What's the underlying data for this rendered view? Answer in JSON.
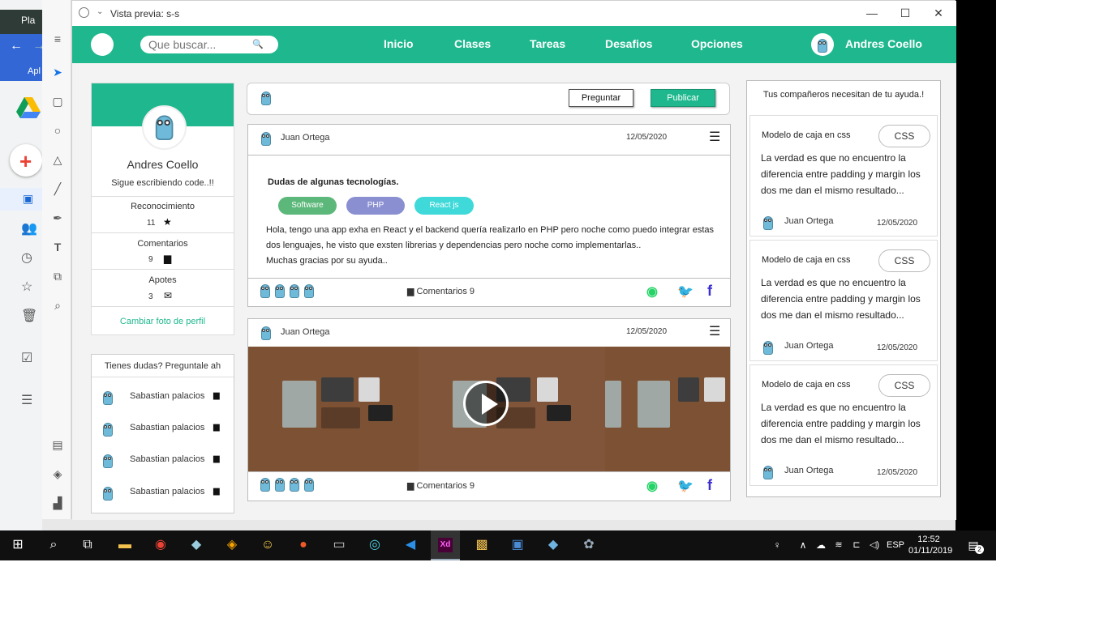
{
  "background": {
    "tab_text": "Pla",
    "apps_label": "Apl"
  },
  "window": {
    "title": "Vista previa: s-s",
    "minimize": "—",
    "maximize": "☐",
    "close": "✕"
  },
  "nav": {
    "search_placeholder": "Que buscar...",
    "links": [
      "Inicio",
      "Clases",
      "Tareas",
      "Desafios",
      "Opciones"
    ],
    "user_name": "Andres Coello"
  },
  "profile": {
    "name": "Andres Coello",
    "subtitle": "Sigue escribiendo code..!!",
    "stats": [
      {
        "label": "Reconocimiento",
        "value": "11",
        "icon": "star-icon"
      },
      {
        "label": "Comentarios",
        "value": "9",
        "icon": "comment-icon"
      },
      {
        "label": "Apotes",
        "value": "3",
        "icon": "mail-icon"
      }
    ],
    "change_photo": "Cambiar  foto de perfil"
  },
  "help": {
    "title": "Tienes dudas? Preguntale ah",
    "users": [
      "Sabastian palacios",
      "Sabastian palacios",
      "Sabastian palacios",
      "Sabastian palacios"
    ]
  },
  "composer": {
    "ask_label": "Preguntar",
    "publish_label": "Publicar"
  },
  "posts": [
    {
      "author": "Juan Ortega",
      "date": "12/05/2020",
      "title": "Dudas de algunas tecnologías.",
      "tags": [
        "Software",
        "PHP",
        "React js"
      ],
      "body": [
        "Hola, tengo una app exha en React y el backend quería realizarlo en PHP pero noche como puedo integrar estas",
        "dos lenguajes, he visto que exsten librerias y dependencias pero noche como implementarlas..",
        "Muchas gracias por su ayuda.."
      ],
      "comments": "Comentarios 9"
    },
    {
      "author": "Juan Ortega",
      "date": "12/05/2020",
      "comments": "Comentarios 9"
    }
  ],
  "right": {
    "title": "Tus compañeros necesitan de tu ayuda.!",
    "cards": [
      {
        "title": "Modelo de caja en css",
        "badge": "CSS",
        "text": "La verdad es que no encuentro la diferencia entre padding y margin los dos me dan el mismo resultado...",
        "author": "Juan Ortega",
        "date": "12/05/2020"
      },
      {
        "title": "Modelo de caja en css",
        "badge": "CSS",
        "text": "La verdad es que no encuentro la diferencia entre padding y margin los dos me dan el mismo resultado...",
        "author": "Juan Ortega",
        "date": "12/05/2020"
      },
      {
        "title": "Modelo de caja en css",
        "badge": "CSS",
        "text": "La verdad es que no encuentro la diferencia entre padding y margin los dos me dan el mismo resultado...",
        "author": "Juan Ortega",
        "date": "12/05/2020"
      }
    ]
  },
  "taskbar": {
    "lang": "ESP",
    "time": "12:52",
    "date": "01/11/2019",
    "notif_count": "2"
  },
  "colors": {
    "brand": "#1fb88e",
    "tag_software": "#5cb87a",
    "tag_php": "#8a8fd1",
    "tag_react": "#3fd9d9",
    "whatsapp": "#25d366",
    "twitter": "#1da1f2",
    "facebook": "#3b2fd1"
  }
}
